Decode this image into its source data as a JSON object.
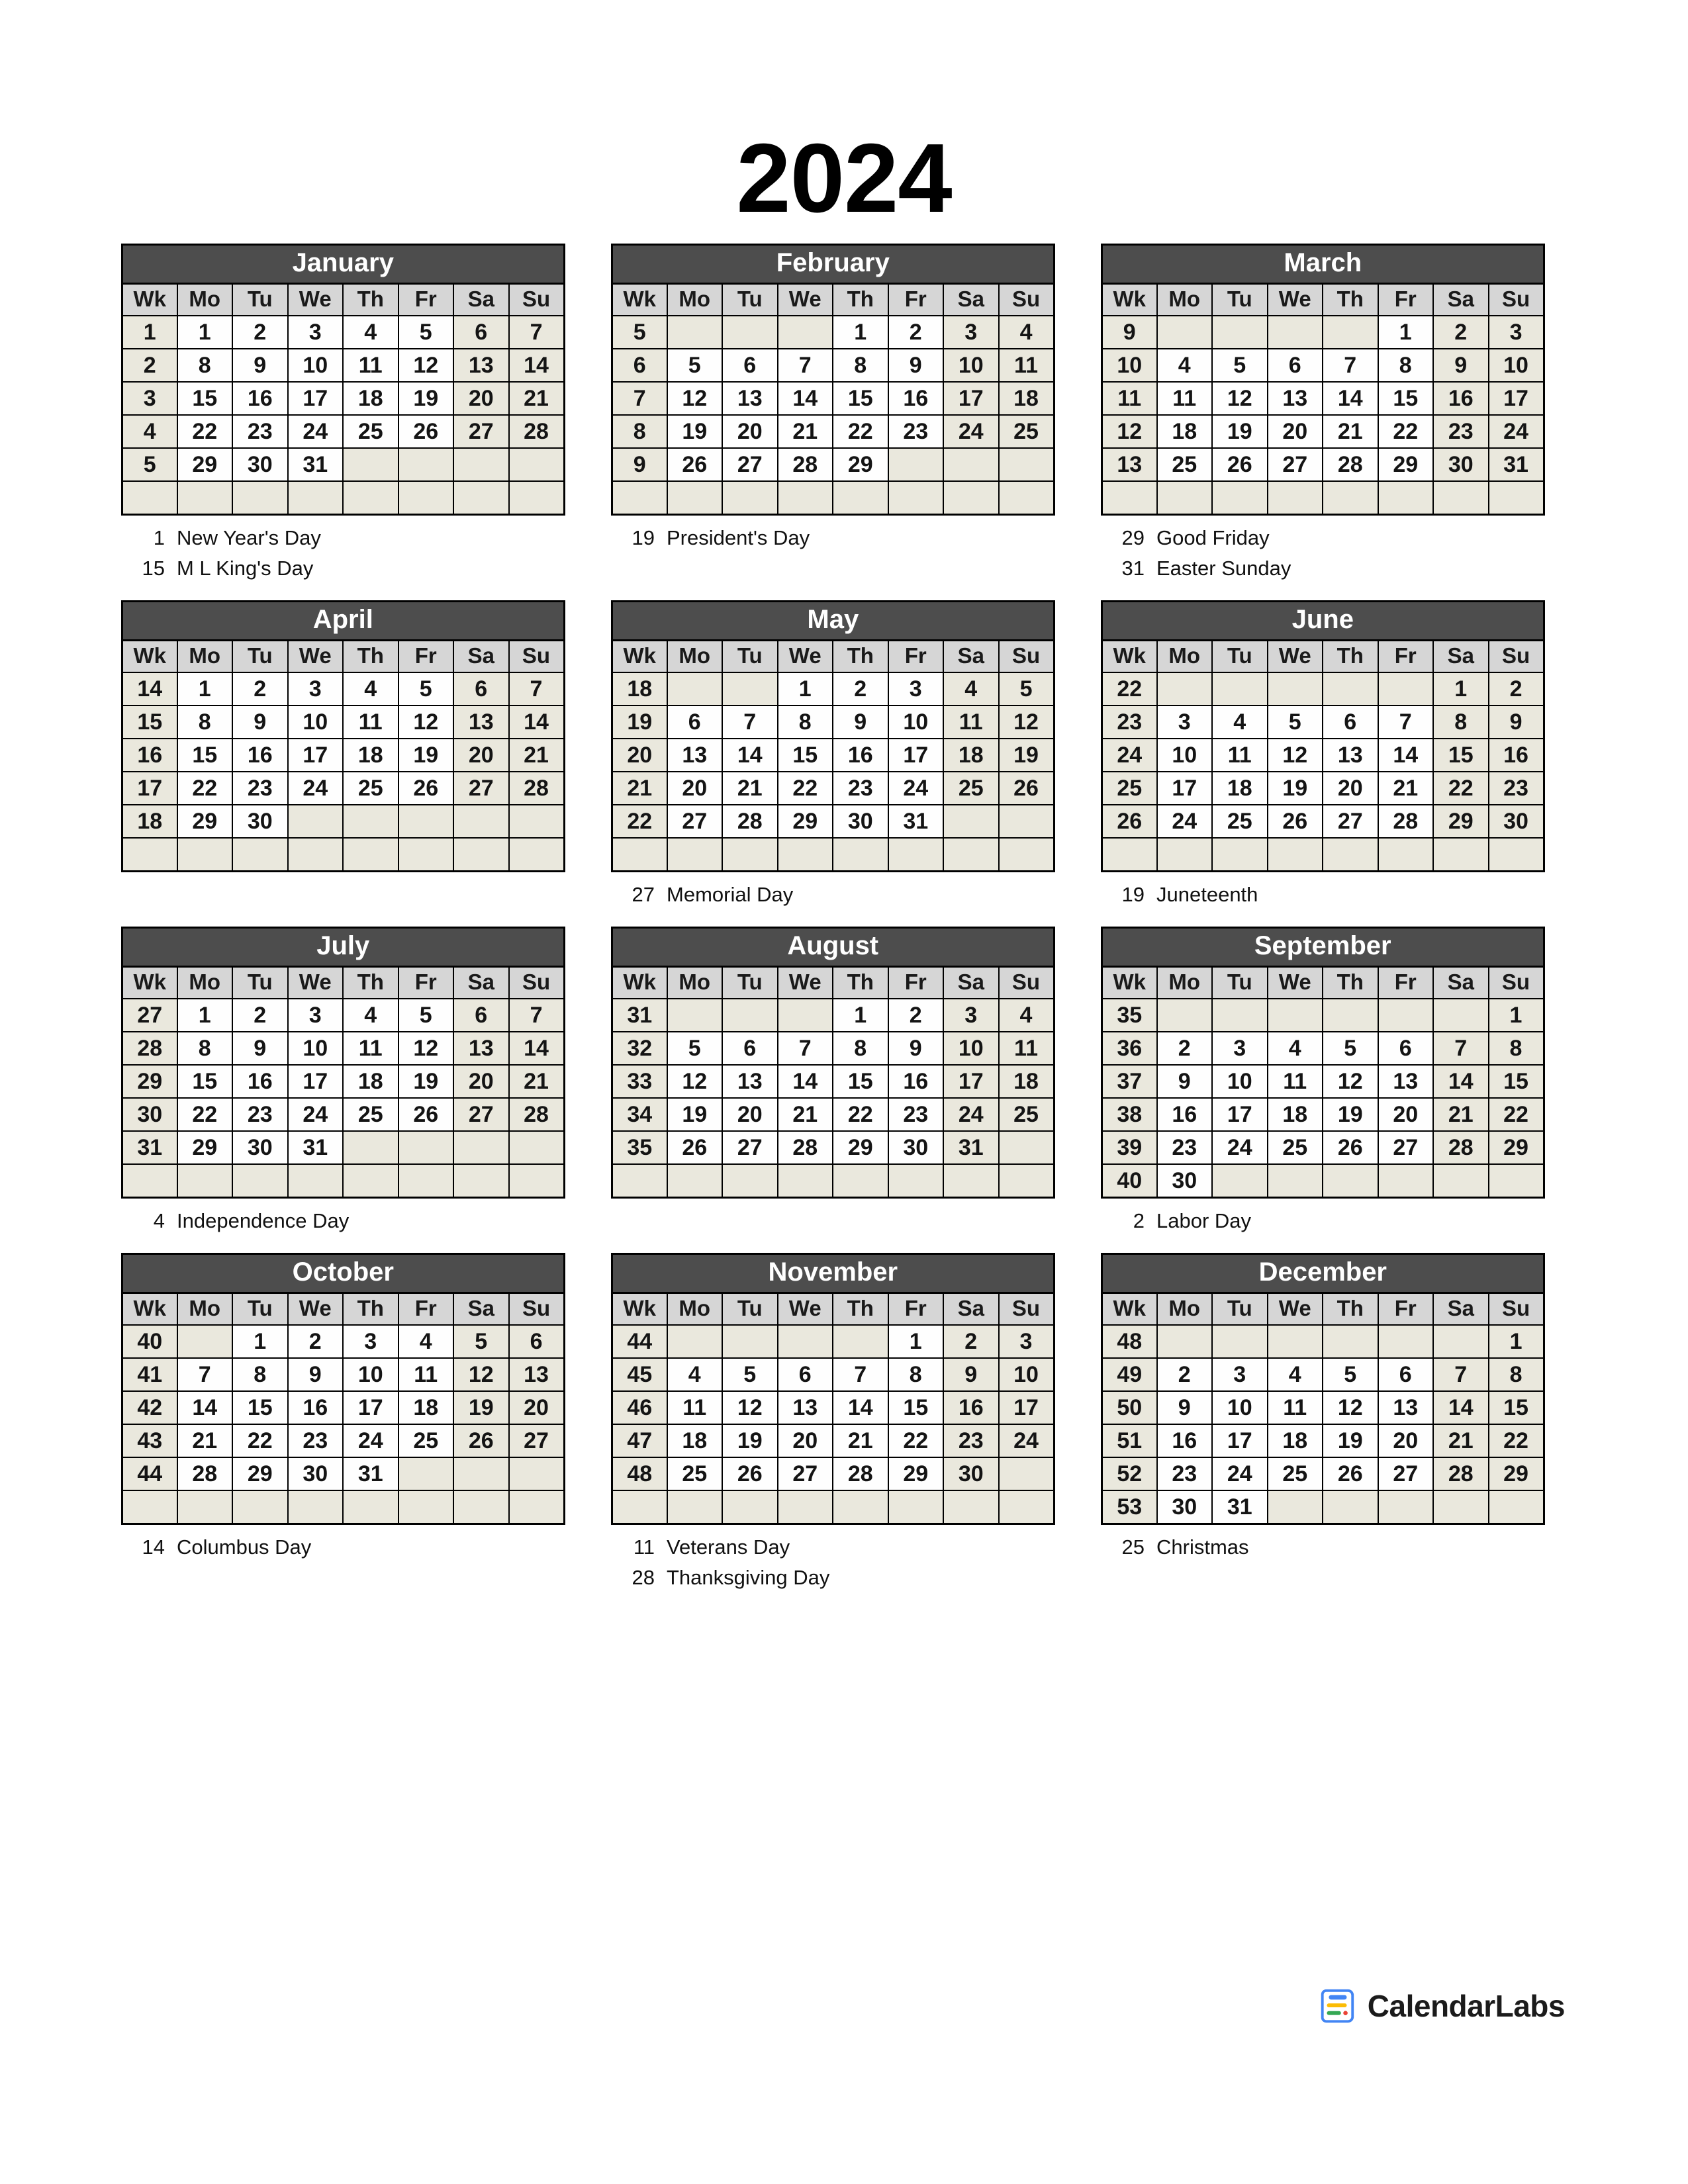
{
  "title": "2024",
  "colors": {
    "month_header_bg": "#4d4d4d",
    "month_header_text": "#ffffff",
    "dow_header_bg": "#d6d6d6",
    "weekend_bg": "#eae8dd",
    "weekday_bg": "#fefefe",
    "grid_line": "#000000",
    "logo_blue": "#4285f4",
    "logo_yellow": "#fbbc05",
    "logo_green": "#34a853",
    "logo_red": "#ea4335"
  },
  "day_headers": [
    "Wk",
    "Mo",
    "Tu",
    "We",
    "Th",
    "Fr",
    "Sa",
    "Su"
  ],
  "footer": {
    "brand": "CalendarLabs",
    "logo_icon": "calendar-book-icon"
  },
  "months": [
    {
      "name": "January",
      "weeks": [
        {
          "wk": "1",
          "days": [
            "1",
            "2",
            "3",
            "4",
            "5",
            "6",
            "7"
          ]
        },
        {
          "wk": "2",
          "days": [
            "8",
            "9",
            "10",
            "11",
            "12",
            "13",
            "14"
          ]
        },
        {
          "wk": "3",
          "days": [
            "15",
            "16",
            "17",
            "18",
            "19",
            "20",
            "21"
          ]
        },
        {
          "wk": "4",
          "days": [
            "22",
            "23",
            "24",
            "25",
            "26",
            "27",
            "28"
          ]
        },
        {
          "wk": "5",
          "days": [
            "29",
            "30",
            "31",
            "",
            "",
            "",
            ""
          ]
        },
        {
          "wk": "",
          "days": [
            "",
            "",
            "",
            "",
            "",
            "",
            ""
          ]
        }
      ],
      "holidays": [
        {
          "day": "1",
          "name": "New Year's Day"
        },
        {
          "day": "15",
          "name": "M L King's Day"
        }
      ]
    },
    {
      "name": "February",
      "weeks": [
        {
          "wk": "5",
          "days": [
            "",
            "",
            "",
            "1",
            "2",
            "3",
            "4"
          ]
        },
        {
          "wk": "6",
          "days": [
            "5",
            "6",
            "7",
            "8",
            "9",
            "10",
            "11"
          ]
        },
        {
          "wk": "7",
          "days": [
            "12",
            "13",
            "14",
            "15",
            "16",
            "17",
            "18"
          ]
        },
        {
          "wk": "8",
          "days": [
            "19",
            "20",
            "21",
            "22",
            "23",
            "24",
            "25"
          ]
        },
        {
          "wk": "9",
          "days": [
            "26",
            "27",
            "28",
            "29",
            "",
            "",
            ""
          ]
        },
        {
          "wk": "",
          "days": [
            "",
            "",
            "",
            "",
            "",
            "",
            ""
          ]
        }
      ],
      "holidays": [
        {
          "day": "19",
          "name": "President's Day"
        }
      ]
    },
    {
      "name": "March",
      "weeks": [
        {
          "wk": "9",
          "days": [
            "",
            "",
            "",
            "",
            "1",
            "2",
            "3"
          ]
        },
        {
          "wk": "10",
          "days": [
            "4",
            "5",
            "6",
            "7",
            "8",
            "9",
            "10"
          ]
        },
        {
          "wk": "11",
          "days": [
            "11",
            "12",
            "13",
            "14",
            "15",
            "16",
            "17"
          ]
        },
        {
          "wk": "12",
          "days": [
            "18",
            "19",
            "20",
            "21",
            "22",
            "23",
            "24"
          ]
        },
        {
          "wk": "13",
          "days": [
            "25",
            "26",
            "27",
            "28",
            "29",
            "30",
            "31"
          ]
        },
        {
          "wk": "",
          "days": [
            "",
            "",
            "",
            "",
            "",
            "",
            ""
          ]
        }
      ],
      "holidays": [
        {
          "day": "29",
          "name": "Good Friday"
        },
        {
          "day": "31",
          "name": "Easter Sunday"
        }
      ]
    },
    {
      "name": "April",
      "weeks": [
        {
          "wk": "14",
          "days": [
            "1",
            "2",
            "3",
            "4",
            "5",
            "6",
            "7"
          ]
        },
        {
          "wk": "15",
          "days": [
            "8",
            "9",
            "10",
            "11",
            "12",
            "13",
            "14"
          ]
        },
        {
          "wk": "16",
          "days": [
            "15",
            "16",
            "17",
            "18",
            "19",
            "20",
            "21"
          ]
        },
        {
          "wk": "17",
          "days": [
            "22",
            "23",
            "24",
            "25",
            "26",
            "27",
            "28"
          ]
        },
        {
          "wk": "18",
          "days": [
            "29",
            "30",
            "",
            "",
            "",
            "",
            ""
          ]
        },
        {
          "wk": "",
          "days": [
            "",
            "",
            "",
            "",
            "",
            "",
            ""
          ]
        }
      ],
      "holidays": []
    },
    {
      "name": "May",
      "weeks": [
        {
          "wk": "18",
          "days": [
            "",
            "",
            "1",
            "2",
            "3",
            "4",
            "5"
          ]
        },
        {
          "wk": "19",
          "days": [
            "6",
            "7",
            "8",
            "9",
            "10",
            "11",
            "12"
          ]
        },
        {
          "wk": "20",
          "days": [
            "13",
            "14",
            "15",
            "16",
            "17",
            "18",
            "19"
          ]
        },
        {
          "wk": "21",
          "days": [
            "20",
            "21",
            "22",
            "23",
            "24",
            "25",
            "26"
          ]
        },
        {
          "wk": "22",
          "days": [
            "27",
            "28",
            "29",
            "30",
            "31",
            "",
            ""
          ]
        },
        {
          "wk": "",
          "days": [
            "",
            "",
            "",
            "",
            "",
            "",
            ""
          ]
        }
      ],
      "holidays": [
        {
          "day": "27",
          "name": "Memorial Day"
        }
      ]
    },
    {
      "name": "June",
      "weeks": [
        {
          "wk": "22",
          "days": [
            "",
            "",
            "",
            "",
            "",
            "1",
            "2"
          ]
        },
        {
          "wk": "23",
          "days": [
            "3",
            "4",
            "5",
            "6",
            "7",
            "8",
            "9"
          ]
        },
        {
          "wk": "24",
          "days": [
            "10",
            "11",
            "12",
            "13",
            "14",
            "15",
            "16"
          ]
        },
        {
          "wk": "25",
          "days": [
            "17",
            "18",
            "19",
            "20",
            "21",
            "22",
            "23"
          ]
        },
        {
          "wk": "26",
          "days": [
            "24",
            "25",
            "26",
            "27",
            "28",
            "29",
            "30"
          ]
        },
        {
          "wk": "",
          "days": [
            "",
            "",
            "",
            "",
            "",
            "",
            ""
          ]
        }
      ],
      "holidays": [
        {
          "day": "19",
          "name": "Juneteenth"
        }
      ]
    },
    {
      "name": "July",
      "weeks": [
        {
          "wk": "27",
          "days": [
            "1",
            "2",
            "3",
            "4",
            "5",
            "6",
            "7"
          ]
        },
        {
          "wk": "28",
          "days": [
            "8",
            "9",
            "10",
            "11",
            "12",
            "13",
            "14"
          ]
        },
        {
          "wk": "29",
          "days": [
            "15",
            "16",
            "17",
            "18",
            "19",
            "20",
            "21"
          ]
        },
        {
          "wk": "30",
          "days": [
            "22",
            "23",
            "24",
            "25",
            "26",
            "27",
            "28"
          ]
        },
        {
          "wk": "31",
          "days": [
            "29",
            "30",
            "31",
            "",
            "",
            "",
            ""
          ]
        },
        {
          "wk": "",
          "days": [
            "",
            "",
            "",
            "",
            "",
            "",
            ""
          ]
        }
      ],
      "holidays": [
        {
          "day": "4",
          "name": "Independence Day"
        }
      ]
    },
    {
      "name": "August",
      "weeks": [
        {
          "wk": "31",
          "days": [
            "",
            "",
            "",
            "1",
            "2",
            "3",
            "4"
          ]
        },
        {
          "wk": "32",
          "days": [
            "5",
            "6",
            "7",
            "8",
            "9",
            "10",
            "11"
          ]
        },
        {
          "wk": "33",
          "days": [
            "12",
            "13",
            "14",
            "15",
            "16",
            "17",
            "18"
          ]
        },
        {
          "wk": "34",
          "days": [
            "19",
            "20",
            "21",
            "22",
            "23",
            "24",
            "25"
          ]
        },
        {
          "wk": "35",
          "days": [
            "26",
            "27",
            "28",
            "29",
            "30",
            "31",
            ""
          ]
        },
        {
          "wk": "",
          "days": [
            "",
            "",
            "",
            "",
            "",
            "",
            ""
          ]
        }
      ],
      "holidays": []
    },
    {
      "name": "September",
      "weeks": [
        {
          "wk": "35",
          "days": [
            "",
            "",
            "",
            "",
            "",
            "",
            "1"
          ]
        },
        {
          "wk": "36",
          "days": [
            "2",
            "3",
            "4",
            "5",
            "6",
            "7",
            "8"
          ]
        },
        {
          "wk": "37",
          "days": [
            "9",
            "10",
            "11",
            "12",
            "13",
            "14",
            "15"
          ]
        },
        {
          "wk": "38",
          "days": [
            "16",
            "17",
            "18",
            "19",
            "20",
            "21",
            "22"
          ]
        },
        {
          "wk": "39",
          "days": [
            "23",
            "24",
            "25",
            "26",
            "27",
            "28",
            "29"
          ]
        },
        {
          "wk": "40",
          "days": [
            "30",
            "",
            "",
            "",
            "",
            "",
            ""
          ]
        }
      ],
      "holidays": [
        {
          "day": "2",
          "name": "Labor Day"
        }
      ]
    },
    {
      "name": "October",
      "weeks": [
        {
          "wk": "40",
          "days": [
            "",
            "1",
            "2",
            "3",
            "4",
            "5",
            "6"
          ]
        },
        {
          "wk": "41",
          "days": [
            "7",
            "8",
            "9",
            "10",
            "11",
            "12",
            "13"
          ]
        },
        {
          "wk": "42",
          "days": [
            "14",
            "15",
            "16",
            "17",
            "18",
            "19",
            "20"
          ]
        },
        {
          "wk": "43",
          "days": [
            "21",
            "22",
            "23",
            "24",
            "25",
            "26",
            "27"
          ]
        },
        {
          "wk": "44",
          "days": [
            "28",
            "29",
            "30",
            "31",
            "",
            "",
            ""
          ]
        },
        {
          "wk": "",
          "days": [
            "",
            "",
            "",
            "",
            "",
            "",
            ""
          ]
        }
      ],
      "holidays": [
        {
          "day": "14",
          "name": "Columbus Day"
        }
      ]
    },
    {
      "name": "November",
      "weeks": [
        {
          "wk": "44",
          "days": [
            "",
            "",
            "",
            "",
            "1",
            "2",
            "3"
          ]
        },
        {
          "wk": "45",
          "days": [
            "4",
            "5",
            "6",
            "7",
            "8",
            "9",
            "10"
          ]
        },
        {
          "wk": "46",
          "days": [
            "11",
            "12",
            "13",
            "14",
            "15",
            "16",
            "17"
          ]
        },
        {
          "wk": "47",
          "days": [
            "18",
            "19",
            "20",
            "21",
            "22",
            "23",
            "24"
          ]
        },
        {
          "wk": "48",
          "days": [
            "25",
            "26",
            "27",
            "28",
            "29",
            "30",
            ""
          ]
        },
        {
          "wk": "",
          "days": [
            "",
            "",
            "",
            "",
            "",
            "",
            ""
          ]
        }
      ],
      "holidays": [
        {
          "day": "11",
          "name": "Veterans Day"
        },
        {
          "day": "28",
          "name": "Thanksgiving Day"
        }
      ]
    },
    {
      "name": "December",
      "weeks": [
        {
          "wk": "48",
          "days": [
            "",
            "",
            "",
            "",
            "",
            "",
            "1"
          ]
        },
        {
          "wk": "49",
          "days": [
            "2",
            "3",
            "4",
            "5",
            "6",
            "7",
            "8"
          ]
        },
        {
          "wk": "50",
          "days": [
            "9",
            "10",
            "11",
            "12",
            "13",
            "14",
            "15"
          ]
        },
        {
          "wk": "51",
          "days": [
            "16",
            "17",
            "18",
            "19",
            "20",
            "21",
            "22"
          ]
        },
        {
          "wk": "52",
          "days": [
            "23",
            "24",
            "25",
            "26",
            "27",
            "28",
            "29"
          ]
        },
        {
          "wk": "53",
          "days": [
            "30",
            "31",
            "",
            "",
            "",
            "",
            ""
          ]
        }
      ],
      "holidays": [
        {
          "day": "25",
          "name": "Christmas"
        }
      ]
    }
  ]
}
